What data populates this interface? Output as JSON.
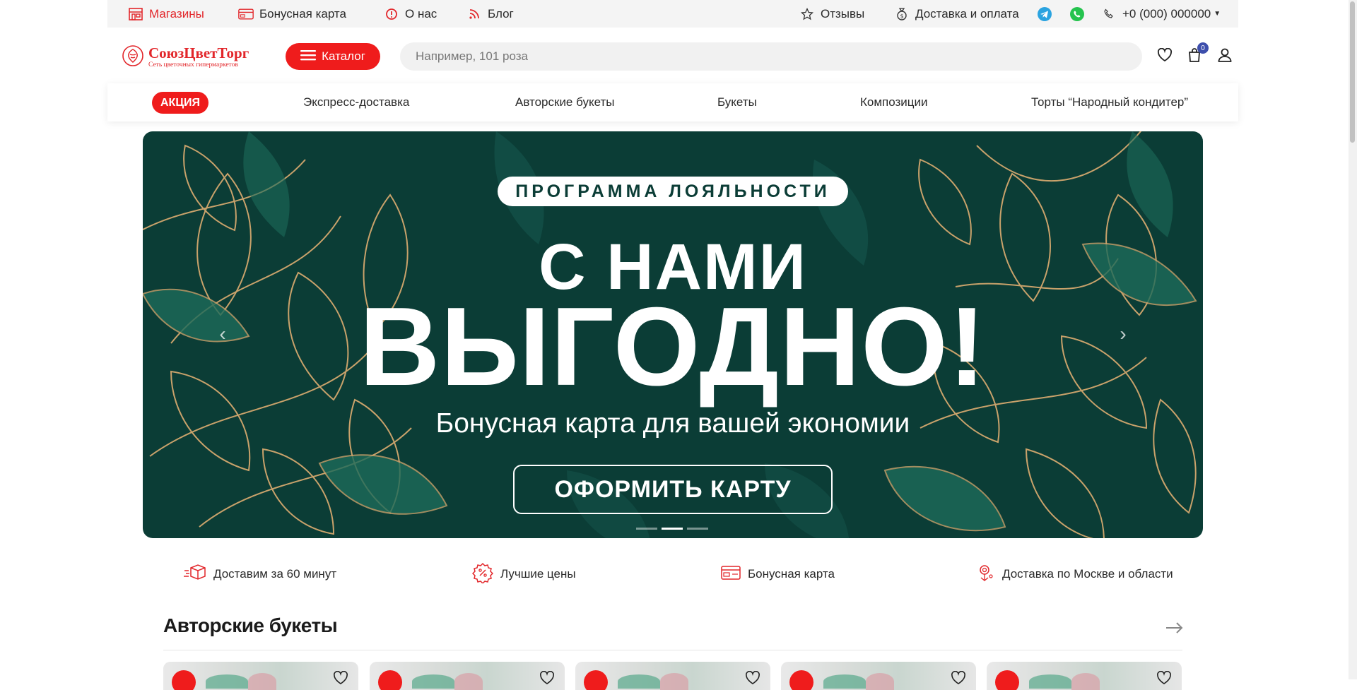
{
  "topbar": {
    "stores": "Магазины",
    "bonus_card": "Бонусная карта",
    "about": "О нас",
    "blog": "Блог",
    "reviews": "Отзывы",
    "delivery": "Доставка и оплата",
    "phone": "+0 (000) 000000"
  },
  "header": {
    "logo_name": "СоюзЦветТорг",
    "logo_sub": "Сеть цветочных гипермаркетов",
    "catalog_label": "Каталог",
    "search_placeholder": "Например, 101 роза",
    "cart_count": "0"
  },
  "nav": {
    "items": [
      "АКЦИЯ",
      "Экспресс-доставка",
      "Авторские букеты",
      "Букеты",
      "Композиции",
      "Торты “Народный кондитер”"
    ]
  },
  "hero": {
    "badge": "ПРОГРАММА ЛОЯЛЬНОСТИ",
    "line1": "С НАМИ",
    "line2": "ВЫГОДНО!",
    "subtitle": "Бонусная карта для вашей экономии",
    "button": "ОФОРМИТЬ КАРТУ",
    "slides_total": 3,
    "active_slide": 2,
    "colors": {
      "background": "#0b3d36",
      "leaf_gold": "#c9a26b",
      "leaf_green": "#1d6b5a"
    }
  },
  "features": [
    {
      "label": "Доставим за 60 минут",
      "icon": "delivery-truck-icon"
    },
    {
      "label": "Лучшие цены",
      "icon": "percent-badge-icon"
    },
    {
      "label": "Бонусная карта",
      "icon": "bonus-card-icon"
    },
    {
      "label": "Доставка по Москве и области",
      "icon": "location-icon"
    }
  ],
  "section": {
    "title": "Авторские букеты"
  },
  "colors": {
    "accent": "#ef1c1c",
    "brand_red": "#e2262a",
    "badge_blue": "#3d4eac"
  }
}
